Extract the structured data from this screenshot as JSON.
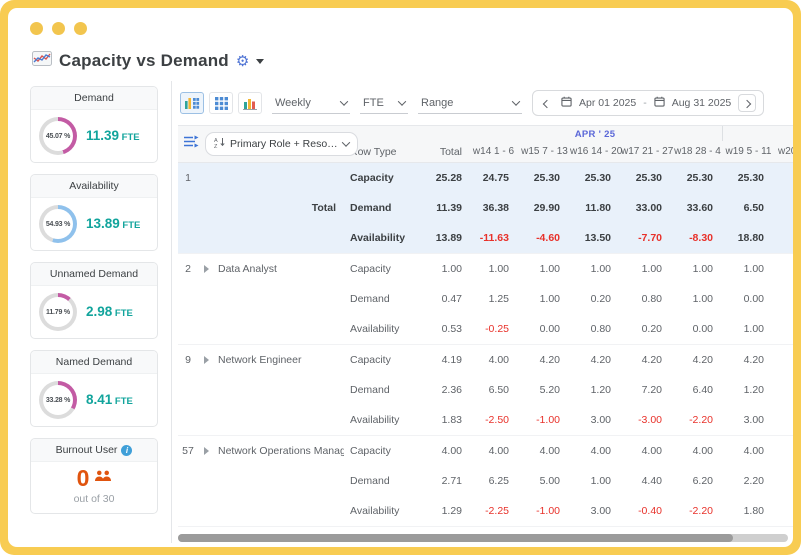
{
  "header": {
    "title": "Capacity vs Demand"
  },
  "icons": {
    "title_chart": "line-chart-icon",
    "settings": "gear-icon",
    "views": [
      "chart-grid-view-icon",
      "grid-view-icon",
      "bar-chart-view-icon"
    ],
    "calendar": "calendar-icon",
    "expand_all": "expand-all-rows-icon",
    "sort": "sort-az-icon",
    "info": "info-icon",
    "people": "people-icon"
  },
  "colors": {
    "frame_yellow": "#F8CC52",
    "teal_value": "#12A49C",
    "demand_pink": "#C35BA4",
    "availability_blue": "#8FC1EC",
    "burnout_orange": "#E0540E",
    "negative_red": "#E8312A",
    "accent_blue": "#4A74D8",
    "month_label_blue": "#5A67D8",
    "donut_rest_gray": "#DCDCDC"
  },
  "sidebar": {
    "cards": [
      {
        "title": "Demand",
        "percent": "45.07 %",
        "value": "11.39",
        "unit": "FTE",
        "arc_color": "#C35BA4",
        "arc_pct": 45.07
      },
      {
        "title": "Availability",
        "percent": "54.93 %",
        "value": "13.89",
        "unit": "FTE",
        "arc_color": "#8FC1EC",
        "arc_pct": 54.93
      },
      {
        "title": "Unnamed Demand",
        "percent": "11.79 %",
        "value": "2.98",
        "unit": "FTE",
        "arc_color": "#C35BA4",
        "arc_pct": 11.79
      },
      {
        "title": "Named Demand",
        "percent": "33.28 %",
        "value": "8.41",
        "unit": "FTE",
        "arc_color": "#C35BA4",
        "arc_pct": 33.28
      }
    ],
    "burnout": {
      "title": "Burnout User",
      "count": "0",
      "caption": "out of 30"
    }
  },
  "toolbar": {
    "selects": [
      {
        "label": "Weekly"
      },
      {
        "label": "FTE"
      },
      {
        "label": "Range"
      }
    ],
    "date_from": "Apr 01 2025",
    "date_sep": "-",
    "date_to": "Aug 31 2025"
  },
  "table": {
    "role_filter": "Primary Role + Resource...",
    "col_row_type": "Row Type",
    "col_total": "Total",
    "month_group": "APR ' 25",
    "weeks": [
      "w14 1 - 6",
      "w15 7 - 13",
      "w16 14 - 20",
      "w17 21 - 27",
      "w18 28 - 4",
      "w19 5 - 11",
      "w20"
    ],
    "groups": [
      {
        "num": "1",
        "name": "Total",
        "highlight": true,
        "expandable": false,
        "rows": [
          {
            "type": "Capacity",
            "total": "25.28",
            "values": [
              "24.75",
              "25.30",
              "25.30",
              "25.30",
              "25.30",
              "25.30"
            ]
          },
          {
            "type": "Demand",
            "total": "11.39",
            "values": [
              "36.38",
              "29.90",
              "11.80",
              "33.00",
              "33.60",
              "6.50"
            ]
          },
          {
            "type": "Availability",
            "total": "13.89",
            "values": [
              "-11.63",
              "-4.60",
              "13.50",
              "-7.70",
              "-8.30",
              "18.80"
            ]
          }
        ]
      },
      {
        "num": "2",
        "name": "Data Analyst",
        "highlight": false,
        "expandable": true,
        "rows": [
          {
            "type": "Capacity",
            "total": "1.00",
            "values": [
              "1.00",
              "1.00",
              "1.00",
              "1.00",
              "1.00",
              "1.00"
            ]
          },
          {
            "type": "Demand",
            "total": "0.47",
            "values": [
              "1.25",
              "1.00",
              "0.20",
              "0.80",
              "1.00",
              "0.00"
            ]
          },
          {
            "type": "Availability",
            "total": "0.53",
            "values": [
              "-0.25",
              "0.00",
              "0.80",
              "0.20",
              "0.00",
              "1.00"
            ]
          }
        ]
      },
      {
        "num": "9",
        "name": "Network Engineer",
        "highlight": false,
        "expandable": true,
        "rows": [
          {
            "type": "Capacity",
            "total": "4.19",
            "values": [
              "4.00",
              "4.20",
              "4.20",
              "4.20",
              "4.20",
              "4.20"
            ]
          },
          {
            "type": "Demand",
            "total": "2.36",
            "values": [
              "6.50",
              "5.20",
              "1.20",
              "7.20",
              "6.40",
              "1.20"
            ]
          },
          {
            "type": "Availability",
            "total": "1.83",
            "values": [
              "-2.50",
              "-1.00",
              "3.00",
              "-3.00",
              "-2.20",
              "3.00"
            ]
          }
        ]
      },
      {
        "num": "57",
        "name": "Network Operations Manager",
        "highlight": false,
        "expandable": true,
        "rows": [
          {
            "type": "Capacity",
            "total": "4.00",
            "values": [
              "4.00",
              "4.00",
              "4.00",
              "4.00",
              "4.00",
              "4.00"
            ]
          },
          {
            "type": "Demand",
            "total": "2.71",
            "values": [
              "6.25",
              "5.00",
              "1.00",
              "4.40",
              "6.20",
              "2.20"
            ]
          },
          {
            "type": "Availability",
            "total": "1.29",
            "values": [
              "-2.25",
              "-1.00",
              "3.00",
              "-0.40",
              "-2.20",
              "1.80"
            ]
          }
        ]
      }
    ]
  }
}
